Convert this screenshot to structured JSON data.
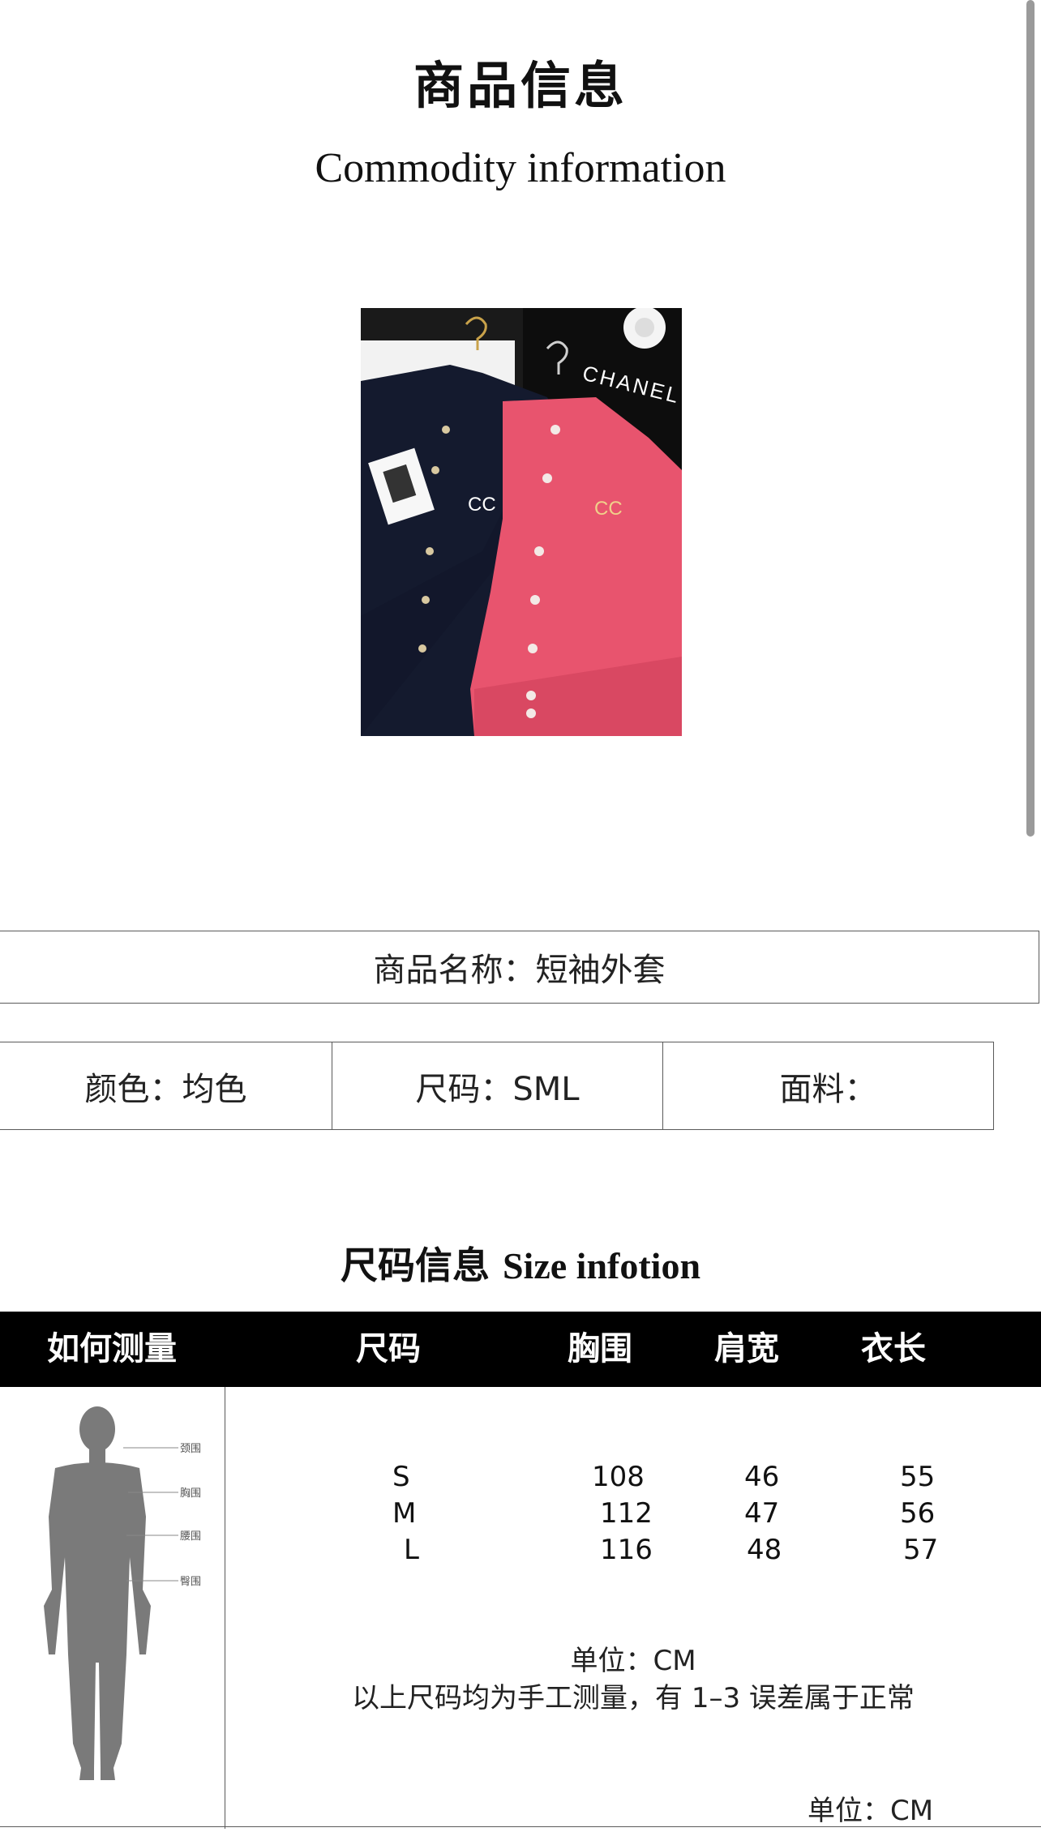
{
  "header": {
    "title_cn": "商品信息",
    "title_en": "Commodity information"
  },
  "photo": {
    "brand_text": "CHANEL"
  },
  "product": {
    "name_line": "商品名称：短袖外套",
    "color_line": "颜色：均色",
    "size_line": "尺码：SML",
    "fabric_line": "面料："
  },
  "size_section": {
    "title_cn": "尺码信息",
    "title_en": "Size infotion",
    "headers": {
      "how_to_measure": "如何测量",
      "size": "尺码",
      "chest": "胸围",
      "shoulder": "肩宽",
      "length": "衣长"
    },
    "rows": [
      {
        "size": "S",
        "chest": "108",
        "shoulder": "46",
        "length": "55"
      },
      {
        "size": "M",
        "chest": "112",
        "shoulder": "47",
        "length": "56"
      },
      {
        "size": "L",
        "chest": "116",
        "shoulder": "48",
        "length": "57"
      }
    ],
    "unit_note": "单位：CM",
    "accuracy_note": "以上尺码均为手工测量，有 1–3 误差属于正常",
    "unit_bottom": "单位：CM",
    "body_labels": [
      "颈围",
      "胸围",
      "腰围",
      "臀围"
    ]
  },
  "colors": {
    "header_bg": "#000000",
    "jacket_navy": "#141a2e",
    "jacket_pink": "#e8546e"
  }
}
